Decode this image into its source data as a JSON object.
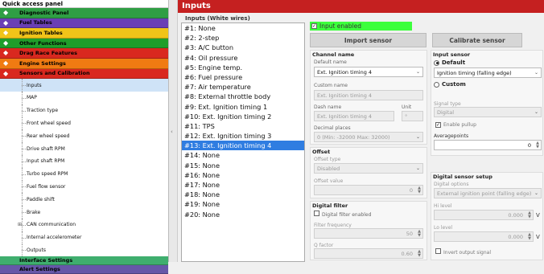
{
  "quick_access": "Quick access panel",
  "categories": [
    {
      "label": "Diagnostic Panel",
      "color": "#2f9e44"
    },
    {
      "label": "Fuel Tables",
      "color": "#6a3fb5"
    },
    {
      "label": "Ignition Tables",
      "color": "#f0c419"
    },
    {
      "label": "Other Functions",
      "color": "#1f9e2a"
    },
    {
      "label": "Drag Race Features",
      "color": "#d9281f"
    },
    {
      "label": "Engine Settings",
      "color": "#f07b12"
    },
    {
      "label": "Sensors and Calibration",
      "color": "#d9281f"
    }
  ],
  "sensor_items": [
    "Inputs",
    "MAP",
    "Traction type",
    "Front wheel speed",
    "Rear wheel speed",
    "Drive shaft RPM",
    "Input shaft RPM",
    "Turbo speed RPM",
    "Fuel flow sensor",
    "Paddle shift",
    "Brake",
    "CAN communication",
    "Internal accelerometer",
    "Outputs"
  ],
  "bottom_categories": [
    {
      "label": "Interface Settings",
      "color": "#3fae6e"
    },
    {
      "label": "Alert Settings",
      "color": "#6657a8"
    }
  ],
  "page_title": "Inputs",
  "inputs_header": "Inputs (White wires)",
  "inputs": [
    "#1: None",
    "#2: 2-step",
    "#3: A/C button",
    "#4: Oil pressure",
    "#5: Engine temp.",
    "#6: Fuel pressure",
    "#7: Air temperature",
    "#8: External throttle body",
    "#9: Ext. Ignition timing 1",
    "#10: Ext. Ignition timing 2",
    "#11: TPS",
    "#12: Ext. Ignition timing 3",
    "#13: Ext. Ignition timing 4",
    "#14: None",
    "#15: None",
    "#16: None",
    "#17: None",
    "#18: None",
    "#19: None",
    "#20: None"
  ],
  "selected_input": 12,
  "input_enabled": "Input enabled",
  "import_sensor": "Import sensor",
  "calibrate_sensor": "Calibrate sensor",
  "channel": {
    "title": "Channel name",
    "default_name_label": "Default name",
    "default_name": "Ext. Ignition timing 4",
    "custom_name_label": "Custom name",
    "custom_name": "Ext. Ignition timing 4",
    "dash_name_label": "Dash name",
    "dash_name": "Ext. Ignition timing 4",
    "unit_label": "Unit",
    "unit": "°",
    "decimal_label": "Decimal places",
    "decimal_value": "0 (Min: -32000  Max: 32000)"
  },
  "offset": {
    "title": "Offset",
    "type_label": "Offset type",
    "type_value": "Disabled",
    "value_label": "Offset value",
    "value": "0"
  },
  "digital_filter": {
    "title": "Digital filter",
    "enabled_label": "Digital filter enabled",
    "freq_label": "Filter frequency",
    "freq_value": "50",
    "q_label": "Q factor",
    "q_value": "0.60"
  },
  "input_sensor": {
    "title": "Input sensor",
    "default_label": "Default",
    "default_value": "Ignition timing (falling edge)",
    "custom_label": "Custom",
    "signal_type_label": "Signal type",
    "signal_type": "Digital",
    "pullup_label": "Enable pullup",
    "avg_label": "Averagepoints",
    "avg_value": "0"
  },
  "digital_setup": {
    "title": "Digital sensor setup",
    "options_label": "Digital options",
    "options_value": "External ignition point (falling edge)",
    "hi_label": "Hi level",
    "hi_value": "0.000",
    "lo_label": "Lo level",
    "lo_value": "0.000",
    "unit": "V",
    "invert_label": "Invert output signal"
  }
}
